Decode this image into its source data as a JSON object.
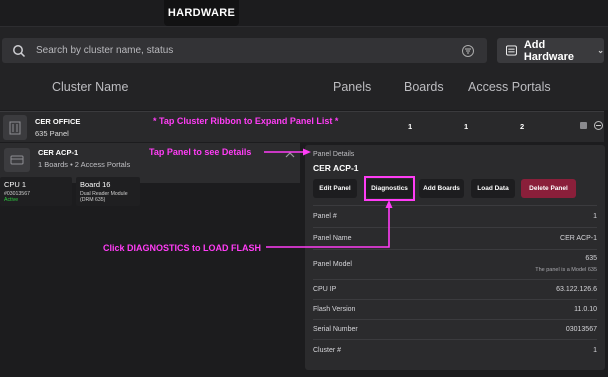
{
  "top_tab": "HARDWARE",
  "search": {
    "placeholder": "Search by cluster name, status"
  },
  "add_hardware": "Add Hardware",
  "columns": {
    "cluster_name": "Cluster Name",
    "panels": "Panels",
    "boards": "Boards",
    "access_portals": "Access Portals"
  },
  "cluster": {
    "name": "CER OFFICE",
    "subtitle": "635 Panel",
    "panels": "1",
    "boards": "1",
    "access_portals": "2"
  },
  "panel": {
    "name": "CER ACP-1",
    "subtitle": "1 Boards • 2 Access Portals",
    "boards": [
      {
        "title": "CPU 1",
        "sub": "#03013567",
        "status": "Active"
      },
      {
        "title": "Board 16",
        "sub": "Dual Reader Module",
        "sub2": "(DRM 635)"
      }
    ]
  },
  "details": {
    "label": "Panel Details",
    "title": "CER ACP-1",
    "buttons": {
      "edit": "Edit Panel",
      "diagnostics": "Diagnostics",
      "add_boards": "Add Boards",
      "load_data": "Load Data",
      "delete": "Delete Panel"
    },
    "rows": [
      {
        "key": "Panel #",
        "value": "1"
      },
      {
        "key": "Panel Name",
        "value": "CER ACP-1"
      },
      {
        "key": "Panel Model",
        "value": "635",
        "note": "The panel is a Model 635"
      },
      {
        "key": "CPU IP",
        "value": "63.122.126.6"
      },
      {
        "key": "Flash Version",
        "value": "11.0.10"
      },
      {
        "key": "Serial Number",
        "value": "03013567"
      },
      {
        "key": "Cluster #",
        "value": "1"
      }
    ]
  },
  "annotations": {
    "tap_cluster": "* Tap Cluster Ribbon to Expand Panel List *",
    "tap_panel": "Tap Panel to see Details",
    "click_diag": "Click DIAGNOSTICS to LOAD FLASH"
  },
  "colors": {
    "annotation": "#ff3df5",
    "delete": "#8a1f3a",
    "active": "#2ecc40"
  }
}
